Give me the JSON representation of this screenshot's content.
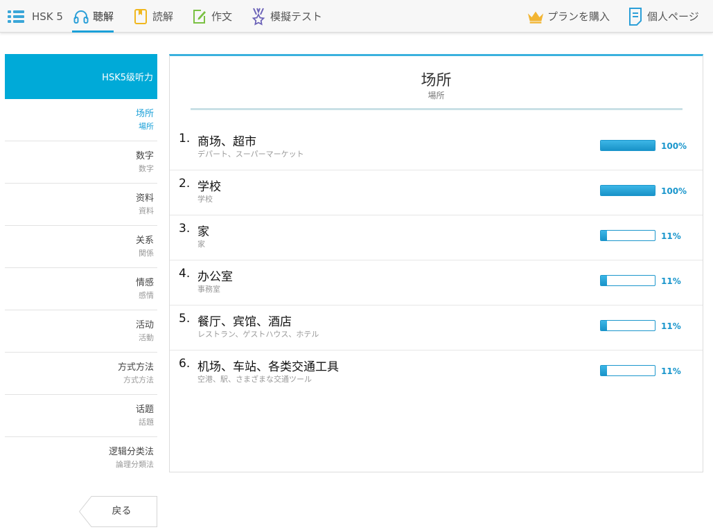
{
  "nav": {
    "level": "HSK 5",
    "tabs": [
      {
        "label": "聴解",
        "icon": "headphones-icon"
      },
      {
        "label": "読解",
        "icon": "book-icon"
      },
      {
        "label": "作文",
        "icon": "edit-icon"
      },
      {
        "label": "模擬テスト",
        "icon": "medal-icon"
      }
    ],
    "plan": {
      "label": "プランを購入",
      "icon": "crown-icon"
    },
    "profile": {
      "label": "個人ページ",
      "icon": "document-icon"
    }
  },
  "sidebar": {
    "title": "HSK5级听力",
    "items": [
      {
        "zh": "场所",
        "ja": "場所"
      },
      {
        "zh": "数字",
        "ja": "数字"
      },
      {
        "zh": "资料",
        "ja": "資料"
      },
      {
        "zh": "关系",
        "ja": "関係"
      },
      {
        "zh": "情感",
        "ja": "感情"
      },
      {
        "zh": "活动",
        "ja": "活動"
      },
      {
        "zh": "方式方法",
        "ja": "方式方法"
      },
      {
        "zh": "话题",
        "ja": "話題"
      },
      {
        "zh": "逻辑分类法",
        "ja": "論理分類法"
      }
    ],
    "back_label": "戻る"
  },
  "main": {
    "title": "场所",
    "subtitle": "場所",
    "lessons": [
      {
        "num": "1.",
        "zh": "商场、超市",
        "ja": "デパート、スーパーマーケット",
        "percent_label": "100%",
        "progress": 1.0
      },
      {
        "num": "2.",
        "zh": "学校",
        "ja": "学校",
        "percent_label": "100%",
        "progress": 1.0
      },
      {
        "num": "3.",
        "zh": "家",
        "ja": "家",
        "percent_label": "11%",
        "progress": 0.11
      },
      {
        "num": "4.",
        "zh": "办公室",
        "ja": "事務室",
        "percent_label": "11%",
        "progress": 0.11
      },
      {
        "num": "5.",
        "zh": "餐厅、宾馆、酒店",
        "ja": "レストラン、ゲストハウス、ホテル",
        "percent_label": "11%",
        "progress": 0.11
      },
      {
        "num": "6.",
        "zh": "机场、车站、各类交通工具",
        "ja": "空港、駅、さまざまな交通ツール",
        "percent_label": "11%",
        "progress": 0.11
      }
    ]
  },
  "colors": {
    "accent": "#00aad8",
    "progress": "#22a7dd",
    "crown": "#f2b533"
  }
}
